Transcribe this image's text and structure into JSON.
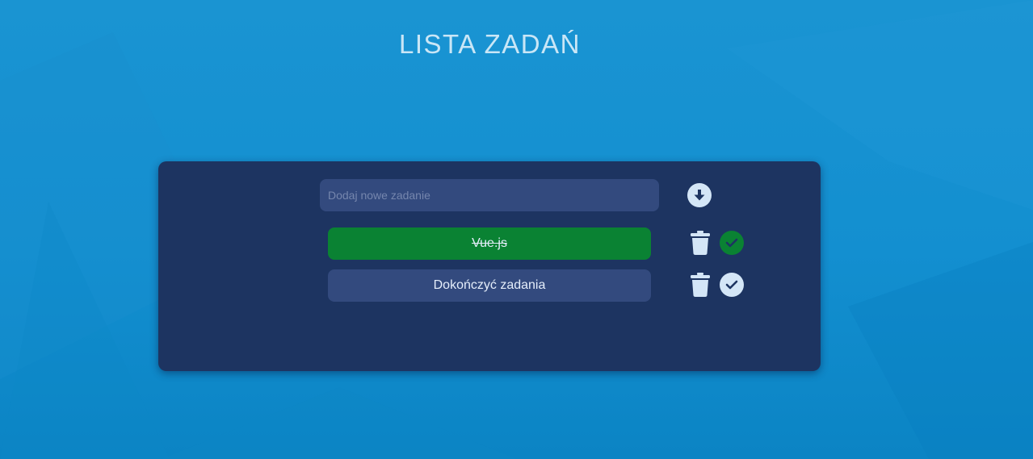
{
  "page": {
    "title": "LISTA ZADAŃ"
  },
  "new_task": {
    "value": "",
    "placeholder": "Dodaj nowe zadanie",
    "add_icon": "arrow-down-circle-icon"
  },
  "tasks": [
    {
      "text": "Vue.js",
      "completed": true,
      "delete_icon": "trash-icon",
      "complete_icon": "check-circle-icon"
    },
    {
      "text": "Dokończyć zadania",
      "completed": false,
      "delete_icon": "trash-icon",
      "complete_icon": "check-circle-icon"
    }
  ],
  "colors": {
    "background": "#1591d1",
    "panel": "#1d3461",
    "input": "#334a7e",
    "completed": "#0a8233",
    "icon_light": "#d4e6f7",
    "icon_dark": "#1d3461",
    "title": "#c9e6f6"
  }
}
